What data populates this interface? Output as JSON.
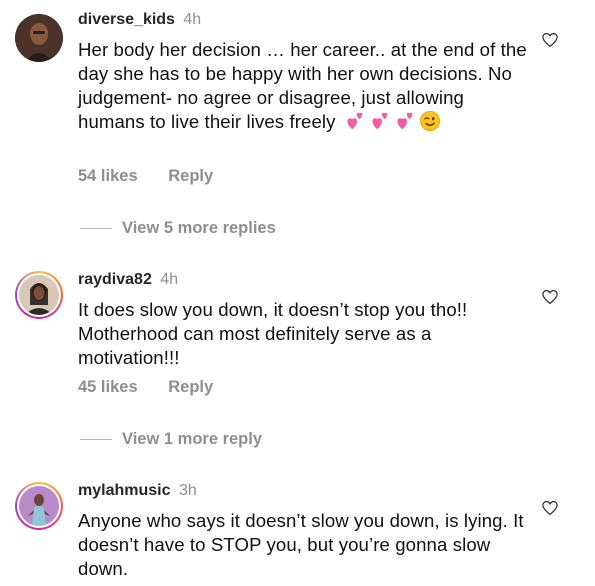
{
  "comments": [
    {
      "username": "diverse_kids",
      "time": "4h",
      "text": "Her body her decision … her career.. at the end of the day she has to be happy with her own decisions. No judgement- no agree or disagree, just allowing humans to live their lives freely",
      "emojis": [
        "two-hearts-emoji",
        "two-hearts-emoji",
        "two-hearts-emoji",
        "winking-face-emoji"
      ],
      "likes": "54 likes",
      "reply_label": "Reply",
      "view_replies": "View 5 more replies"
    },
    {
      "username": "raydiva82",
      "time": "4h",
      "text": "It does slow you down, it doesn’t stop you tho!! Motherhood can most definitely serve as a motivation!!!",
      "likes": "45 likes",
      "reply_label": "Reply",
      "view_replies": "View 1 more reply"
    },
    {
      "username": "mylahmusic",
      "time": "3h",
      "text": "Anyone who says it doesn’t slow you down, is lying. It doesn’t have to STOP you, but you’re gonna slow down."
    }
  ],
  "colors": {
    "secondary_text": "#8e8e8e",
    "primary_text": "#262626"
  },
  "icons": {
    "like": "heart-outline-icon"
  }
}
